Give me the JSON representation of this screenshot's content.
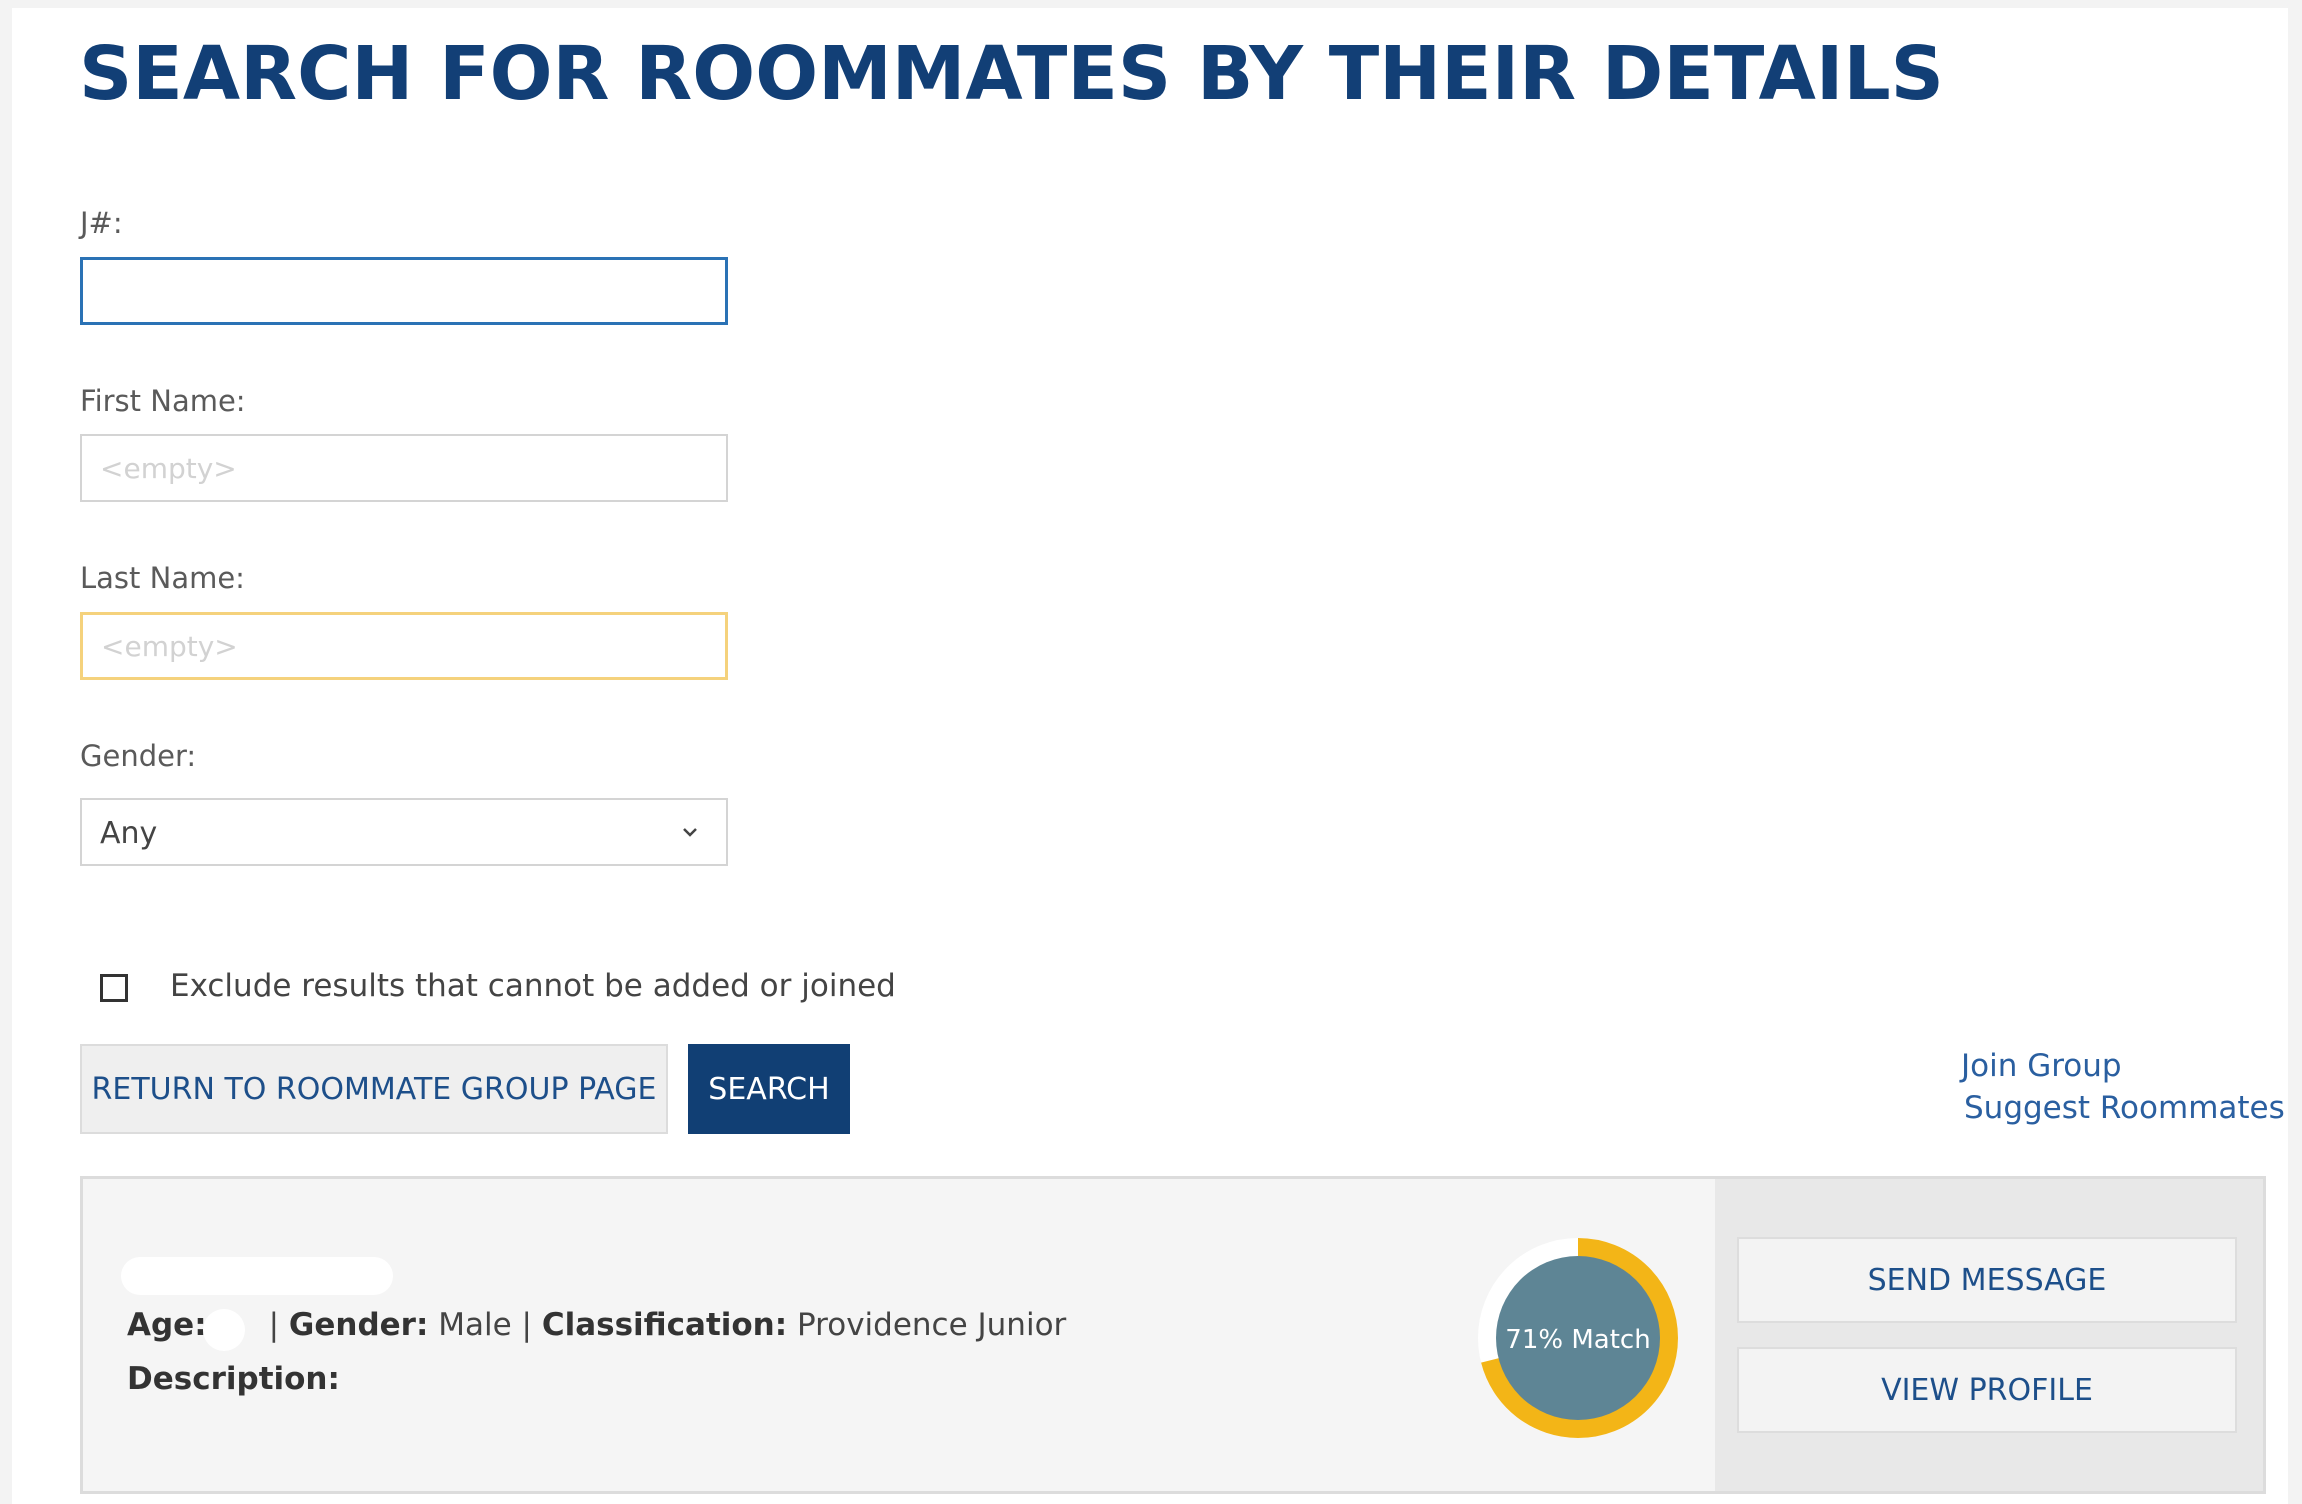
{
  "page": {
    "title": "SEARCH FOR ROOMMATES BY THEIR DETAILS"
  },
  "form": {
    "jnum": {
      "label": "J#:",
      "value": ""
    },
    "first_name": {
      "label": "First Name:",
      "placeholder": "<empty>"
    },
    "last_name": {
      "label": "Last Name:",
      "placeholder": "<empty>"
    },
    "gender": {
      "label": "Gender:",
      "selected": "Any"
    },
    "exclude_checkbox": {
      "label": "Exclude results that cannot be added or joined",
      "checked": false
    }
  },
  "buttons": {
    "return": "RETURN TO ROOMMATE GROUP PAGE",
    "search": "SEARCH"
  },
  "side_links": {
    "join_group": "Join Group",
    "suggest_roommates": "Suggest Roommates"
  },
  "result": {
    "age_label": "Age:",
    "gender_label": "Gender:",
    "gender_value": "Male",
    "classification_label": "Classification:",
    "classification_value": "Providence Junior",
    "separator": "|",
    "description_label": "Description:",
    "match_percent": 71,
    "match_text": "71% Match",
    "send_message": "SEND MESSAGE",
    "view_profile": "VIEW PROFILE"
  },
  "colors": {
    "title": "#123f76",
    "primary_button": "#113f74",
    "link": "#2a5fa0",
    "match_ring": "#f3b517",
    "match_circle": "#5e8595"
  }
}
